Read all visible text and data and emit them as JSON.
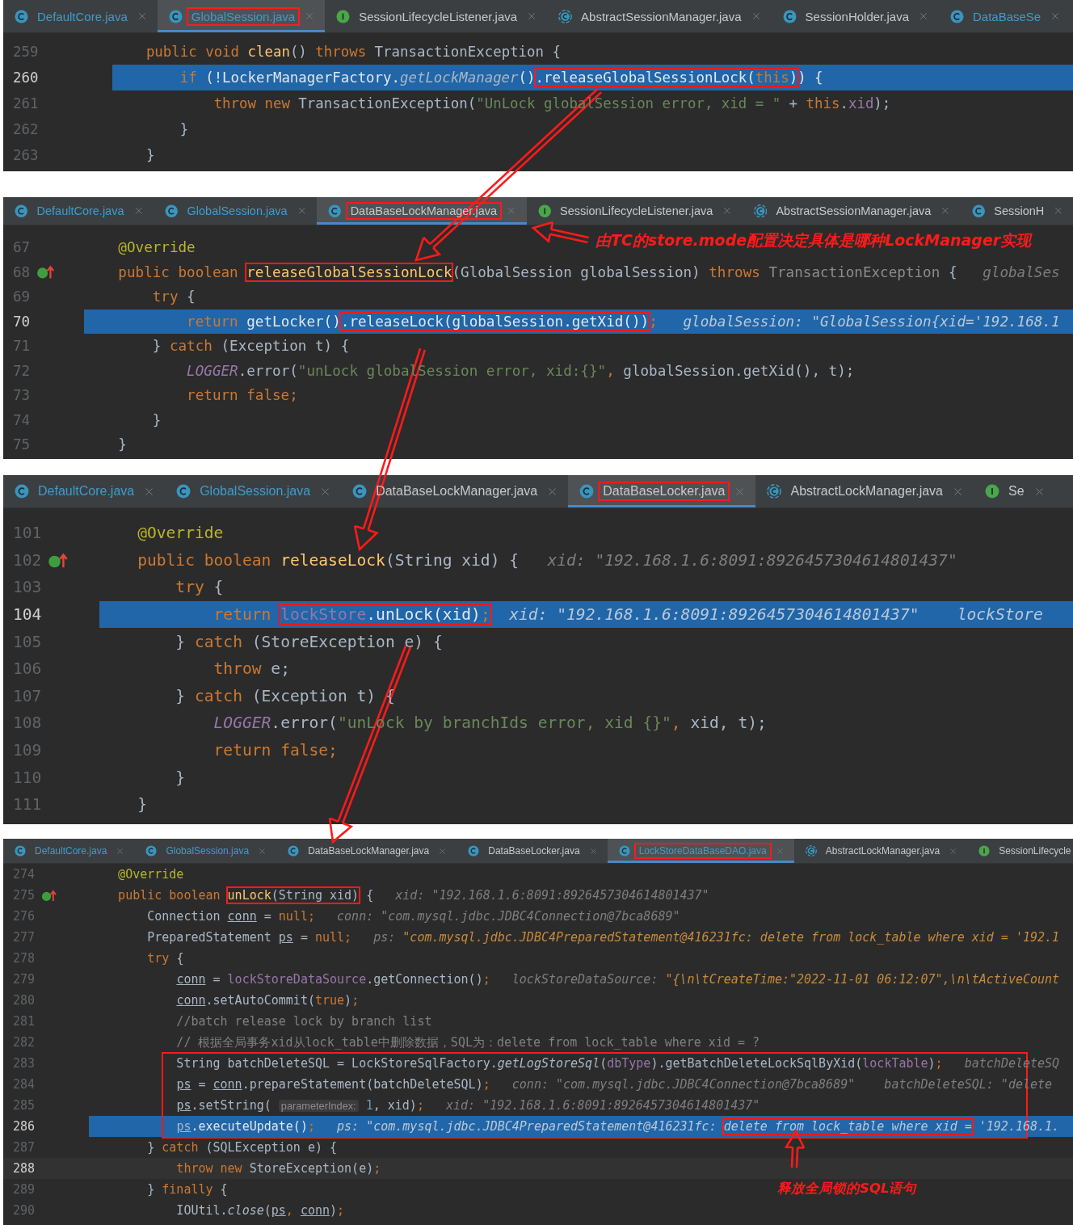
{
  "panels": [
    {
      "tabs": [
        {
          "label": "DefaultCore.java",
          "kind": "class",
          "selected": false,
          "modified": true,
          "framed": false
        },
        {
          "label": "GlobalSession.java",
          "kind": "class",
          "selected": true,
          "modified": true,
          "framed": true
        },
        {
          "label": "SessionLifecycleListener.java",
          "kind": "interface",
          "selected": false,
          "modified": false,
          "framed": false
        },
        {
          "label": "AbstractSessionManager.java",
          "kind": "abstract",
          "selected": false,
          "modified": false,
          "framed": false
        },
        {
          "label": "SessionHolder.java",
          "kind": "class",
          "selected": false,
          "modified": false,
          "framed": false
        },
        {
          "label": "DataBaseSe",
          "kind": "class",
          "selected": false,
          "modified": true,
          "framed": false
        }
      ],
      "blocks": [
        {
          "framed": false,
          "lines": [
            {
              "number": "259",
              "selected": false,
              "caret": false,
              "overrides": false,
              "tokens": [
                {
                  "kind": "kw",
                  "text": "    public void "
                },
                {
                  "kind": "fn",
                  "text": "clean"
                },
                {
                  "kind": "plain",
                  "text": "() "
                },
                {
                  "kind": "kw",
                  "text": "throws "
                },
                {
                  "kind": "plain",
                  "text": "TransactionException {"
                }
              ]
            },
            {
              "number": "260",
              "selected": true,
              "caret": false,
              "overrides": false,
              "tokens": [
                {
                  "kind": "kw",
                  "text": "        if "
                },
                {
                  "kind": "plain",
                  "text": "(!LockerManagerFactory."
                },
                {
                  "kind": "static_i",
                  "text": "getLockManager"
                },
                {
                  "kind": "plain",
                  "text": "()"
                },
                {
                  "kind": "frame",
                  "tokens": [
                    {
                      "kind": "plain",
                      "text": ".releaseGlobalSessionLock("
                    },
                    {
                      "kind": "kw",
                      "text": "this"
                    },
                    {
                      "kind": "plain",
                      "text": ")"
                    }
                  ]
                },
                {
                  "kind": "plain",
                  "text": ") {"
                }
              ]
            },
            {
              "number": "261",
              "selected": false,
              "caret": false,
              "overrides": false,
              "tokens": [
                {
                  "kind": "kw",
                  "text": "            throw new "
                },
                {
                  "kind": "plain",
                  "text": "TransactionException("
                },
                {
                  "kind": "str",
                  "text": "\"UnLock globalSession error, xid = \""
                },
                {
                  "kind": "plain",
                  "text": " + "
                },
                {
                  "kind": "kw",
                  "text": "this"
                },
                {
                  "kind": "plain",
                  "text": "."
                },
                {
                  "kind": "field",
                  "text": "xid"
                },
                {
                  "kind": "plain",
                  "text": ");"
                }
              ]
            },
            {
              "number": "262",
              "selected": false,
              "caret": false,
              "overrides": false,
              "tokens": [
                {
                  "kind": "plain",
                  "text": "        }"
                }
              ]
            },
            {
              "number": "263",
              "selected": false,
              "caret": false,
              "overrides": false,
              "tokens": [
                {
                  "kind": "plain",
                  "text": "    }"
                }
              ]
            }
          ]
        }
      ]
    },
    {
      "tabs": [
        {
          "label": "DefaultCore.java",
          "kind": "class",
          "selected": false,
          "modified": true,
          "framed": false
        },
        {
          "label": "GlobalSession.java",
          "kind": "class",
          "selected": false,
          "modified": true,
          "framed": false
        },
        {
          "label": "DataBaseLockManager.java",
          "kind": "class",
          "selected": true,
          "modified": false,
          "framed": true
        },
        {
          "label": "SessionLifecycleListener.java",
          "kind": "interface",
          "selected": false,
          "modified": false,
          "framed": false
        },
        {
          "label": "AbstractSessionManager.java",
          "kind": "abstract",
          "selected": false,
          "modified": false,
          "framed": false
        },
        {
          "label": "SessionH",
          "kind": "class",
          "selected": false,
          "modified": false,
          "framed": false
        }
      ],
      "blocks": [
        {
          "framed": false,
          "lines": [
            {
              "number": "67",
              "selected": false,
              "caret": false,
              "overrides": false,
              "tokens": [
                {
                  "kind": "ann",
                  "text": "    @Override"
                }
              ]
            },
            {
              "number": "68",
              "selected": false,
              "caret": false,
              "overrides": true,
              "tokens": [
                {
                  "kind": "kw",
                  "text": "    public boolean "
                },
                {
                  "kind": "frame",
                  "tokens": [
                    {
                      "kind": "fn",
                      "text": "releaseGlobalSessionLock"
                    }
                  ]
                },
                {
                  "kind": "plain",
                  "text": "(GlobalSession globalSession) "
                },
                {
                  "kind": "kw",
                  "text": "throws "
                },
                {
                  "kind": "dim",
                  "text": "TransactionException "
                },
                {
                  "kind": "plain",
                  "text": "{"
                },
                {
                  "kind": "hint",
                  "text": "   globalSes"
                }
              ]
            },
            {
              "number": "69",
              "selected": false,
              "caret": false,
              "overrides": false,
              "tokens": [
                {
                  "kind": "kw",
                  "text": "        try "
                },
                {
                  "kind": "plain",
                  "text": "{"
                }
              ]
            },
            {
              "number": "70",
              "selected": true,
              "caret": false,
              "overrides": false,
              "tokens": [
                {
                  "kind": "kw",
                  "text": "            return "
                },
                {
                  "kind": "plain",
                  "text": "getLocker()"
                },
                {
                  "kind": "frame",
                  "tokens": [
                    {
                      "kind": "plain",
                      "text": ".releaseLock(globalSession.getXid())"
                    }
                  ]
                },
                {
                  "kind": "kw",
                  "text": ";"
                },
                {
                  "kind": "hint",
                  "text": "   globalSession: \"GlobalSession{xid='192.168.1"
                }
              ]
            },
            {
              "number": "71",
              "selected": false,
              "caret": false,
              "overrides": false,
              "tokens": [
                {
                  "kind": "plain",
                  "text": "        } "
                },
                {
                  "kind": "kw",
                  "text": "catch "
                },
                {
                  "kind": "plain",
                  "text": "(Exception t) {"
                }
              ]
            },
            {
              "number": "72",
              "selected": false,
              "caret": false,
              "overrides": false,
              "tokens": [
                {
                  "kind": "field_i",
                  "text": "            LOGGER"
                },
                {
                  "kind": "plain",
                  "text": ".error("
                },
                {
                  "kind": "str",
                  "text": "\"unLock globalSession error, xid:{}\""
                },
                {
                  "kind": "kw",
                  "text": ", "
                },
                {
                  "kind": "plain",
                  "text": "globalSession.getXid(), t);"
                }
              ]
            },
            {
              "number": "73",
              "selected": false,
              "caret": false,
              "overrides": false,
              "tokens": [
                {
                  "kind": "kw",
                  "text": "            return false;"
                }
              ]
            },
            {
              "number": "74",
              "selected": false,
              "caret": false,
              "overrides": false,
              "tokens": [
                {
                  "kind": "plain",
                  "text": "        }"
                }
              ]
            },
            {
              "number": "75",
              "selected": false,
              "caret": false,
              "overrides": false,
              "tokens": [
                {
                  "kind": "plain",
                  "text": "    }"
                }
              ]
            }
          ]
        }
      ]
    },
    {
      "tabs": [
        {
          "label": "DefaultCore.java",
          "kind": "class",
          "selected": false,
          "modified": true,
          "framed": false
        },
        {
          "label": "GlobalSession.java",
          "kind": "class",
          "selected": false,
          "modified": true,
          "framed": false
        },
        {
          "label": "DataBaseLockManager.java",
          "kind": "class",
          "selected": false,
          "modified": false,
          "framed": false
        },
        {
          "label": "DataBaseLocker.java",
          "kind": "class",
          "selected": true,
          "modified": false,
          "framed": true
        },
        {
          "label": "AbstractLockManager.java",
          "kind": "abstract",
          "selected": false,
          "modified": false,
          "framed": false
        },
        {
          "label": "Se",
          "kind": "interface",
          "selected": false,
          "modified": false,
          "framed": false
        }
      ],
      "blocks": [
        {
          "framed": false,
          "lines": [
            {
              "number": "101",
              "selected": false,
              "caret": false,
              "overrides": false,
              "tokens": [
                {
                  "kind": "ann",
                  "text": "    @Override"
                }
              ]
            },
            {
              "number": "102",
              "selected": false,
              "caret": false,
              "overrides": true,
              "tokens": [
                {
                  "kind": "kw",
                  "text": "    public boolean "
                },
                {
                  "kind": "fn",
                  "text": "releaseLock"
                },
                {
                  "kind": "plain",
                  "text": "(String xid) {"
                },
                {
                  "kind": "hint",
                  "text": "   xid: \"192.168.1.6:8091:8926457304614801437\""
                }
              ]
            },
            {
              "number": "103",
              "selected": false,
              "caret": false,
              "overrides": false,
              "tokens": [
                {
                  "kind": "kw",
                  "text": "        try "
                },
                {
                  "kind": "plain",
                  "text": "{"
                }
              ]
            },
            {
              "number": "104",
              "selected": true,
              "caret": false,
              "overrides": false,
              "tokens": [
                {
                  "kind": "kw",
                  "text": "            return "
                },
                {
                  "kind": "frame",
                  "tokens": [
                    {
                      "kind": "field",
                      "text": "lockStore"
                    },
                    {
                      "kind": "plain",
                      "text": ".unLock(xid)"
                    },
                    {
                      "kind": "kw",
                      "text": ";"
                    }
                  ]
                },
                {
                  "kind": "hint",
                  "text": "  xid: \"192.168.1.6:8091:8926457304614801437\"    lockStore"
                }
              ]
            },
            {
              "number": "105",
              "selected": false,
              "caret": false,
              "overrides": false,
              "tokens": [
                {
                  "kind": "plain",
                  "text": "        } "
                },
                {
                  "kind": "kw",
                  "text": "catch "
                },
                {
                  "kind": "plain",
                  "text": "(StoreException e) {"
                }
              ]
            },
            {
              "number": "106",
              "selected": false,
              "caret": false,
              "overrides": false,
              "tokens": [
                {
                  "kind": "kw",
                  "text": "            throw "
                },
                {
                  "kind": "plain",
                  "text": "e;"
                }
              ]
            },
            {
              "number": "107",
              "selected": false,
              "caret": false,
              "overrides": false,
              "tokens": [
                {
                  "kind": "plain",
                  "text": "        } "
                },
                {
                  "kind": "kw",
                  "text": "catch "
                },
                {
                  "kind": "plain",
                  "text": "(Exception t) {"
                }
              ]
            },
            {
              "number": "108",
              "selected": false,
              "caret": false,
              "overrides": false,
              "tokens": [
                {
                  "kind": "field_i",
                  "text": "            LOGGER"
                },
                {
                  "kind": "plain",
                  "text": ".error("
                },
                {
                  "kind": "str",
                  "text": "\"unLock by branchIds error, xid {}\""
                },
                {
                  "kind": "kw",
                  "text": ", "
                },
                {
                  "kind": "plain",
                  "text": "xid, t);"
                }
              ]
            },
            {
              "number": "109",
              "selected": false,
              "caret": false,
              "overrides": false,
              "tokens": [
                {
                  "kind": "kw",
                  "text": "            return false;"
                }
              ]
            },
            {
              "number": "110",
              "selected": false,
              "caret": false,
              "overrides": false,
              "tokens": [
                {
                  "kind": "plain",
                  "text": "        }"
                }
              ]
            },
            {
              "number": "111",
              "selected": false,
              "caret": false,
              "overrides": false,
              "tokens": [
                {
                  "kind": "plain",
                  "text": "    }"
                }
              ]
            }
          ]
        }
      ]
    },
    {
      "tabs": [
        {
          "label": "DefaultCore.java",
          "kind": "class",
          "selected": false,
          "modified": true,
          "framed": false
        },
        {
          "label": "GlobalSession.java",
          "kind": "class",
          "selected": false,
          "modified": true,
          "framed": false
        },
        {
          "label": "DataBaseLockManager.java",
          "kind": "class",
          "selected": false,
          "modified": false,
          "framed": false
        },
        {
          "label": "DataBaseLocker.java",
          "kind": "class",
          "selected": false,
          "modified": false,
          "framed": false
        },
        {
          "label": "LockStoreDataBaseDAO.java",
          "kind": "class",
          "selected": true,
          "modified": true,
          "framed": true
        },
        {
          "label": "AbstractLockManager.java",
          "kind": "abstract",
          "selected": false,
          "modified": false,
          "framed": false
        },
        {
          "label": "SessionLifecycle",
          "kind": "interface",
          "selected": false,
          "modified": false,
          "framed": false
        }
      ],
      "blocks": [
        {
          "framed": false,
          "lines": [
            {
              "number": "274",
              "selected": false,
              "caret": false,
              "overrides": false,
              "tokens": [
                {
                  "kind": "ann",
                  "text": "    @Override"
                }
              ]
            },
            {
              "number": "275",
              "selected": false,
              "caret": false,
              "overrides": true,
              "tokens": [
                {
                  "kind": "kw",
                  "text": "    public boolean "
                },
                {
                  "kind": "frame",
                  "tokens": [
                    {
                      "kind": "fn",
                      "text": "unLock"
                    },
                    {
                      "kind": "plain",
                      "text": "(String xid)"
                    }
                  ]
                },
                {
                  "kind": "plain",
                  "text": " {"
                },
                {
                  "kind": "hint",
                  "text": "   xid: \"192.168.1.6:8091:8926457304614801437\""
                }
              ]
            },
            {
              "number": "276",
              "selected": false,
              "caret": false,
              "overrides": false,
              "tokens": [
                {
                  "kind": "plain",
                  "text": "        Connection "
                },
                {
                  "kind": "var_ul",
                  "text": "conn"
                },
                {
                  "kind": "plain",
                  "text": " = "
                },
                {
                  "kind": "kw",
                  "text": "null;"
                },
                {
                  "kind": "hint",
                  "text": "   conn: \"com.mysql.jdbc.JDBC4Connection@7bca8689\""
                }
              ]
            },
            {
              "number": "277",
              "selected": false,
              "caret": false,
              "overrides": false,
              "tokens": [
                {
                  "kind": "plain",
                  "text": "        PreparedStatement "
                },
                {
                  "kind": "var_ul",
                  "text": "ps"
                },
                {
                  "kind": "plain",
                  "text": " = "
                },
                {
                  "kind": "kw",
                  "text": "null;"
                },
                {
                  "kind": "hint",
                  "text": "   ps: "
                },
                {
                  "kind": "hint_str",
                  "text": "\"com.mysql.jdbc.JDBC4PreparedStatement@416231fc: delete from lock_table where xid = '192.1"
                }
              ]
            },
            {
              "number": "278",
              "selected": false,
              "caret": false,
              "overrides": false,
              "tokens": [
                {
                  "kind": "kw",
                  "text": "        try "
                },
                {
                  "kind": "plain",
                  "text": "{"
                }
              ]
            },
            {
              "number": "279",
              "selected": false,
              "caret": false,
              "overrides": false,
              "tokens": [
                {
                  "kind": "var_ul",
                  "text": "            conn"
                },
                {
                  "kind": "plain",
                  "text": " = "
                },
                {
                  "kind": "field",
                  "text": "lockStoreDataSource"
                },
                {
                  "kind": "plain",
                  "text": ".getConnection()"
                },
                {
                  "kind": "kw",
                  "text": ";"
                },
                {
                  "kind": "hint",
                  "text": "   lockStoreDataSource: "
                },
                {
                  "kind": "hint_str",
                  "text": "\"{\\n\\tCreateTime:\"2022-11-01 06:12:07\",\\n\\tActiveCount"
                }
              ]
            },
            {
              "number": "280",
              "selected": false,
              "caret": false,
              "overrides": false,
              "tokens": [
                {
                  "kind": "var_ul",
                  "text": "            conn"
                },
                {
                  "kind": "plain",
                  "text": ".setAutoCommit("
                },
                {
                  "kind": "kw",
                  "text": "true"
                },
                {
                  "kind": "plain",
                  "text": ")"
                },
                {
                  "kind": "kw",
                  "text": ";"
                }
              ]
            },
            {
              "number": "281",
              "selected": false,
              "caret": false,
              "overrides": false,
              "tokens": [
                {
                  "kind": "comment",
                  "text": "            //batch release lock by branch list"
                }
              ]
            },
            {
              "number": "282",
              "selected": false,
              "caret": false,
              "overrides": false,
              "tokens": [
                {
                  "kind": "comment",
                  "text": "            // 根据全局事务xid从lock_table中删除数据，SQL为：delete from lock_table where xid = ?"
                }
              ]
            }
          ]
        },
        {
          "framed": true,
          "lines": [
            {
              "number": "283",
              "selected": false,
              "caret": false,
              "overrides": false,
              "tokens": [
                {
                  "kind": "plain",
                  "text": "            String batchDeleteSQL = LockStoreSqlFactory."
                },
                {
                  "kind": "static_i",
                  "text": "getLogStoreSql"
                },
                {
                  "kind": "plain",
                  "text": "("
                },
                {
                  "kind": "field",
                  "text": "dbType"
                },
                {
                  "kind": "plain",
                  "text": ").getBatchDeleteLockSqlByXid("
                },
                {
                  "kind": "field",
                  "text": "lockTable"
                },
                {
                  "kind": "plain",
                  "text": ")"
                },
                {
                  "kind": "kw",
                  "text": ";"
                },
                {
                  "kind": "hint",
                  "text": "   batchDeleteSQ"
                }
              ]
            },
            {
              "number": "284",
              "selected": false,
              "caret": false,
              "overrides": false,
              "tokens": [
                {
                  "kind": "var_ul",
                  "text": "            ps"
                },
                {
                  "kind": "plain",
                  "text": " = "
                },
                {
                  "kind": "var_ul",
                  "text": "conn"
                },
                {
                  "kind": "plain",
                  "text": ".prepareStatement(batchDeleteSQL)"
                },
                {
                  "kind": "kw",
                  "text": ";"
                },
                {
                  "kind": "hint",
                  "text": "   conn: \"com.mysql.jdbc.JDBC4Connection@7bca8689\"    batchDeleteSQL: \"delete"
                }
              ]
            },
            {
              "number": "285",
              "selected": false,
              "caret": false,
              "overrides": false,
              "tokens": [
                {
                  "kind": "var_ul",
                  "text": "            ps"
                },
                {
                  "kind": "plain",
                  "text": ".setString( "
                },
                {
                  "kind": "param_hint",
                  "text": "parameterIndex:"
                },
                {
                  "kind": "num",
                  "text": " 1"
                },
                {
                  "kind": "plain",
                  "text": ", xid)"
                },
                {
                  "kind": "kw",
                  "text": ";"
                },
                {
                  "kind": "hint",
                  "text": "   xid: \"192.168.1.6:8091:8926457304614801437\""
                }
              ]
            },
            {
              "number": "286",
              "selected": true,
              "caret": false,
              "overrides": false,
              "tokens": [
                {
                  "kind": "var_ul",
                  "text": "            ps"
                },
                {
                  "kind": "plain",
                  "text": ".executeUpdate()"
                },
                {
                  "kind": "kw",
                  "text": ";"
                },
                {
                  "kind": "hint",
                  "text": "   ps: \"com.mysql.jdbc.JDBC4PreparedStatement@416231fc: "
                },
                {
                  "kind": "frame",
                  "tokens": [
                    {
                      "kind": "hint",
                      "text": "delete from lock_table where xid ="
                    }
                  ]
                },
                {
                  "kind": "hint",
                  "text": " '192.168.1."
                }
              ]
            }
          ]
        },
        {
          "framed": false,
          "lines": [
            {
              "number": "287",
              "selected": false,
              "caret": false,
              "overrides": false,
              "tokens": [
                {
                  "kind": "plain",
                  "text": "        } "
                },
                {
                  "kind": "kw",
                  "text": "catch "
                },
                {
                  "kind": "plain",
                  "text": "(SQLException e) {"
                }
              ]
            },
            {
              "number": "288",
              "selected": false,
              "caret": true,
              "overrides": false,
              "tokens": [
                {
                  "kind": "kw",
                  "text": "            throw new "
                },
                {
                  "kind": "plain",
                  "text": "StoreException(e)"
                },
                {
                  "kind": "kw",
                  "text": ";"
                }
              ]
            },
            {
              "number": "289",
              "selected": false,
              "caret": false,
              "overrides": false,
              "tokens": [
                {
                  "kind": "plain",
                  "text": "        } "
                },
                {
                  "kind": "kw",
                  "text": "finally "
                },
                {
                  "kind": "plain",
                  "text": "{"
                }
              ]
            },
            {
              "number": "290",
              "selected": false,
              "caret": false,
              "overrides": false,
              "tokens": [
                {
                  "kind": "plain",
                  "text": "            IOUtil."
                },
                {
                  "kind": "static_i",
                  "text": "close"
                },
                {
                  "kind": "plain",
                  "text": "("
                },
                {
                  "kind": "var_ul",
                  "text": "ps"
                },
                {
                  "kind": "kw",
                  "text": ", "
                },
                {
                  "kind": "var_ul",
                  "text": "conn"
                },
                {
                  "kind": "plain",
                  "text": ")"
                },
                {
                  "kind": "kw",
                  "text": ";"
                }
              ]
            }
          ]
        }
      ]
    }
  ],
  "annotations": [
    {
      "text": "由TC的store.mode配置决定具体是哪种LockManager实现"
    },
    {
      "text": "释放全局锁的SQL语句"
    }
  ]
}
